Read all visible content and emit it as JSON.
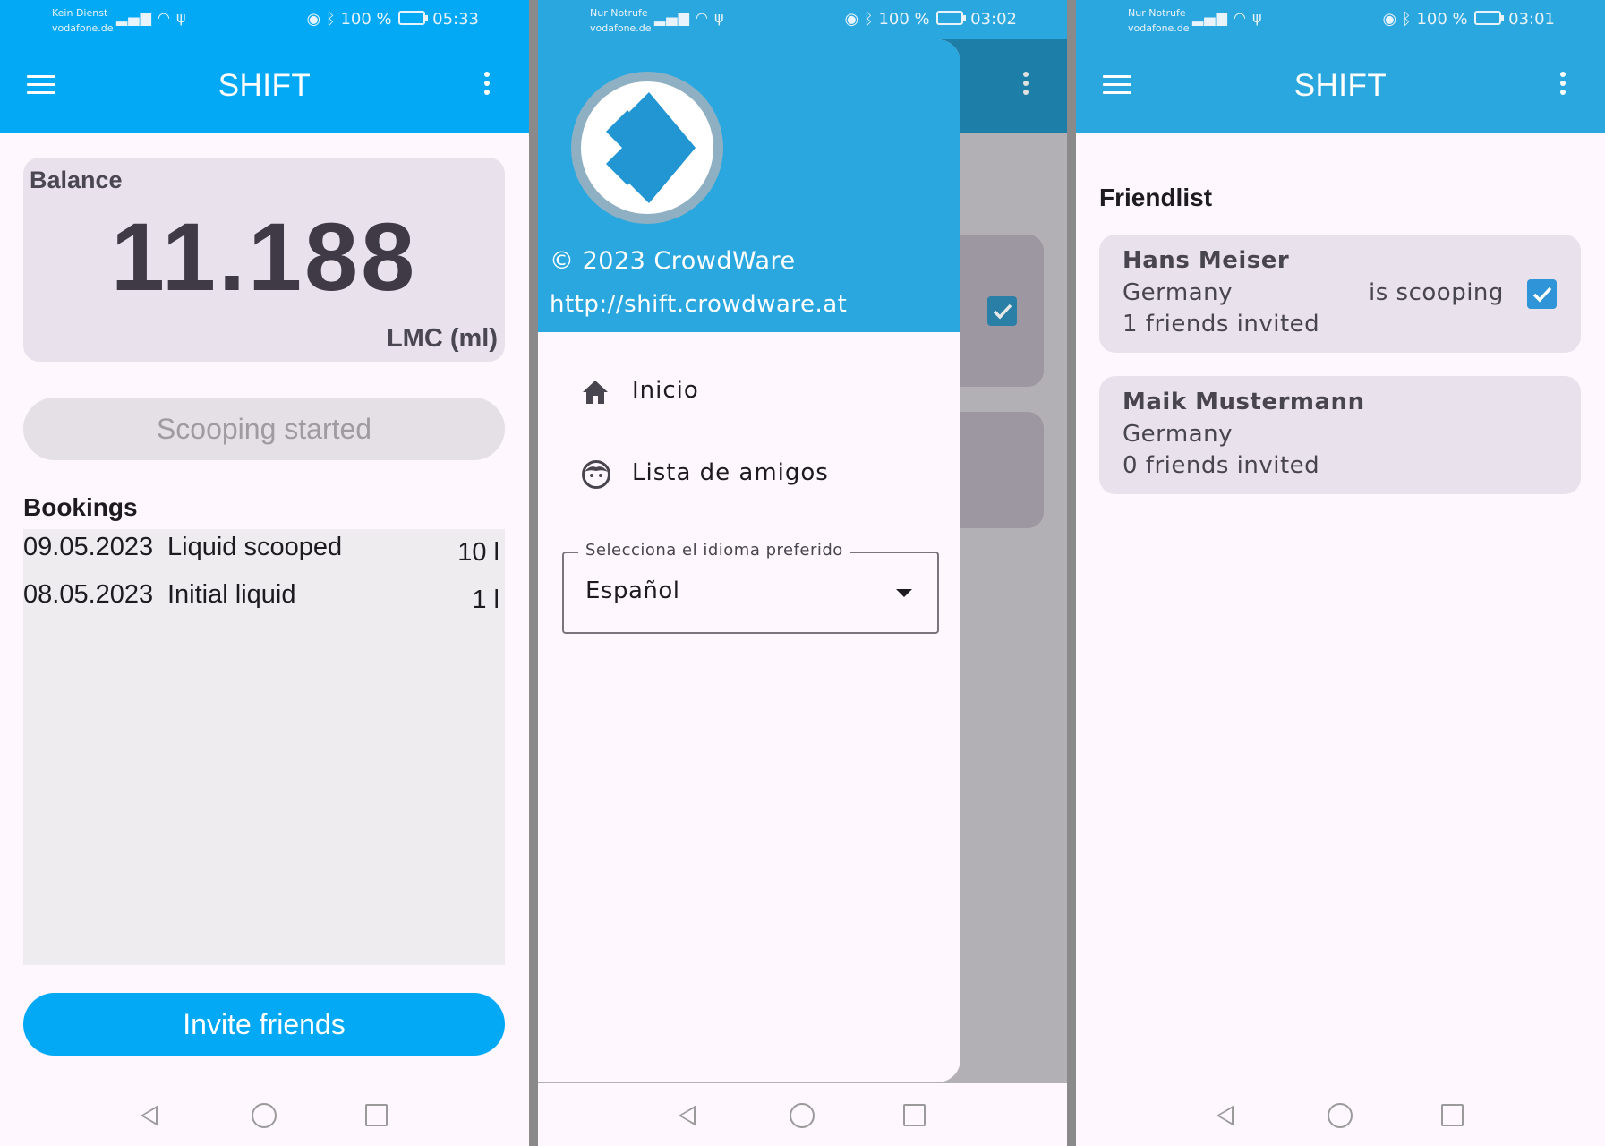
{
  "screens": [
    {
      "status_bar": {
        "carrier_line1": "Kein Dienst",
        "carrier_line2": "vodafone.de",
        "battery": "100 %",
        "time": "05:33"
      },
      "app_title": "SHIFT",
      "balance": {
        "label": "Balance",
        "value": "11.188",
        "unit": "LMC (ml)"
      },
      "scoop_button": "Scooping started",
      "bookings_title": "Bookings",
      "bookings": [
        {
          "date": "09.05.2023",
          "description": "Liquid scooped",
          "amount": "10 l"
        },
        {
          "date": "08.05.2023",
          "description": "Initial liquid",
          "amount": "1 l"
        }
      ],
      "invite_button": "Invite friends"
    },
    {
      "status_bar": {
        "carrier_line1": "Nur Notrufe",
        "carrier_line2": "vodafone.de",
        "battery": "100 %",
        "time": "03:02"
      },
      "drawer": {
        "copyright": "© 2023 CrowdWare",
        "url": "http://shift.crowdware.at",
        "items": [
          {
            "label": "Inicio",
            "icon": "home-icon"
          },
          {
            "label": "Lista de amigos",
            "icon": "face-icon"
          }
        ],
        "language_label": "Selecciona el idioma preferido",
        "language_value": "Español"
      }
    },
    {
      "status_bar": {
        "carrier_line1": "Nur Notrufe",
        "carrier_line2": "vodafone.de",
        "battery": "100 %",
        "time": "03:01"
      },
      "app_title": "SHIFT",
      "friendlist_title": "Friendlist",
      "friends": [
        {
          "name": "Hans Meiser",
          "country": "Germany",
          "invited": "1 friends invited",
          "status": "is scooping",
          "checked": true
        },
        {
          "name": "Maik Mustermann",
          "country": "Germany",
          "invited": "0 friends invited",
          "status": "",
          "checked": false
        }
      ]
    }
  ],
  "colors": {
    "app_bar": "#03a9f4",
    "app_bar_alt": "#2ba7df",
    "card": "#e9e2ec",
    "background": "#fef7fe",
    "checkbox": "#2f95d8"
  }
}
